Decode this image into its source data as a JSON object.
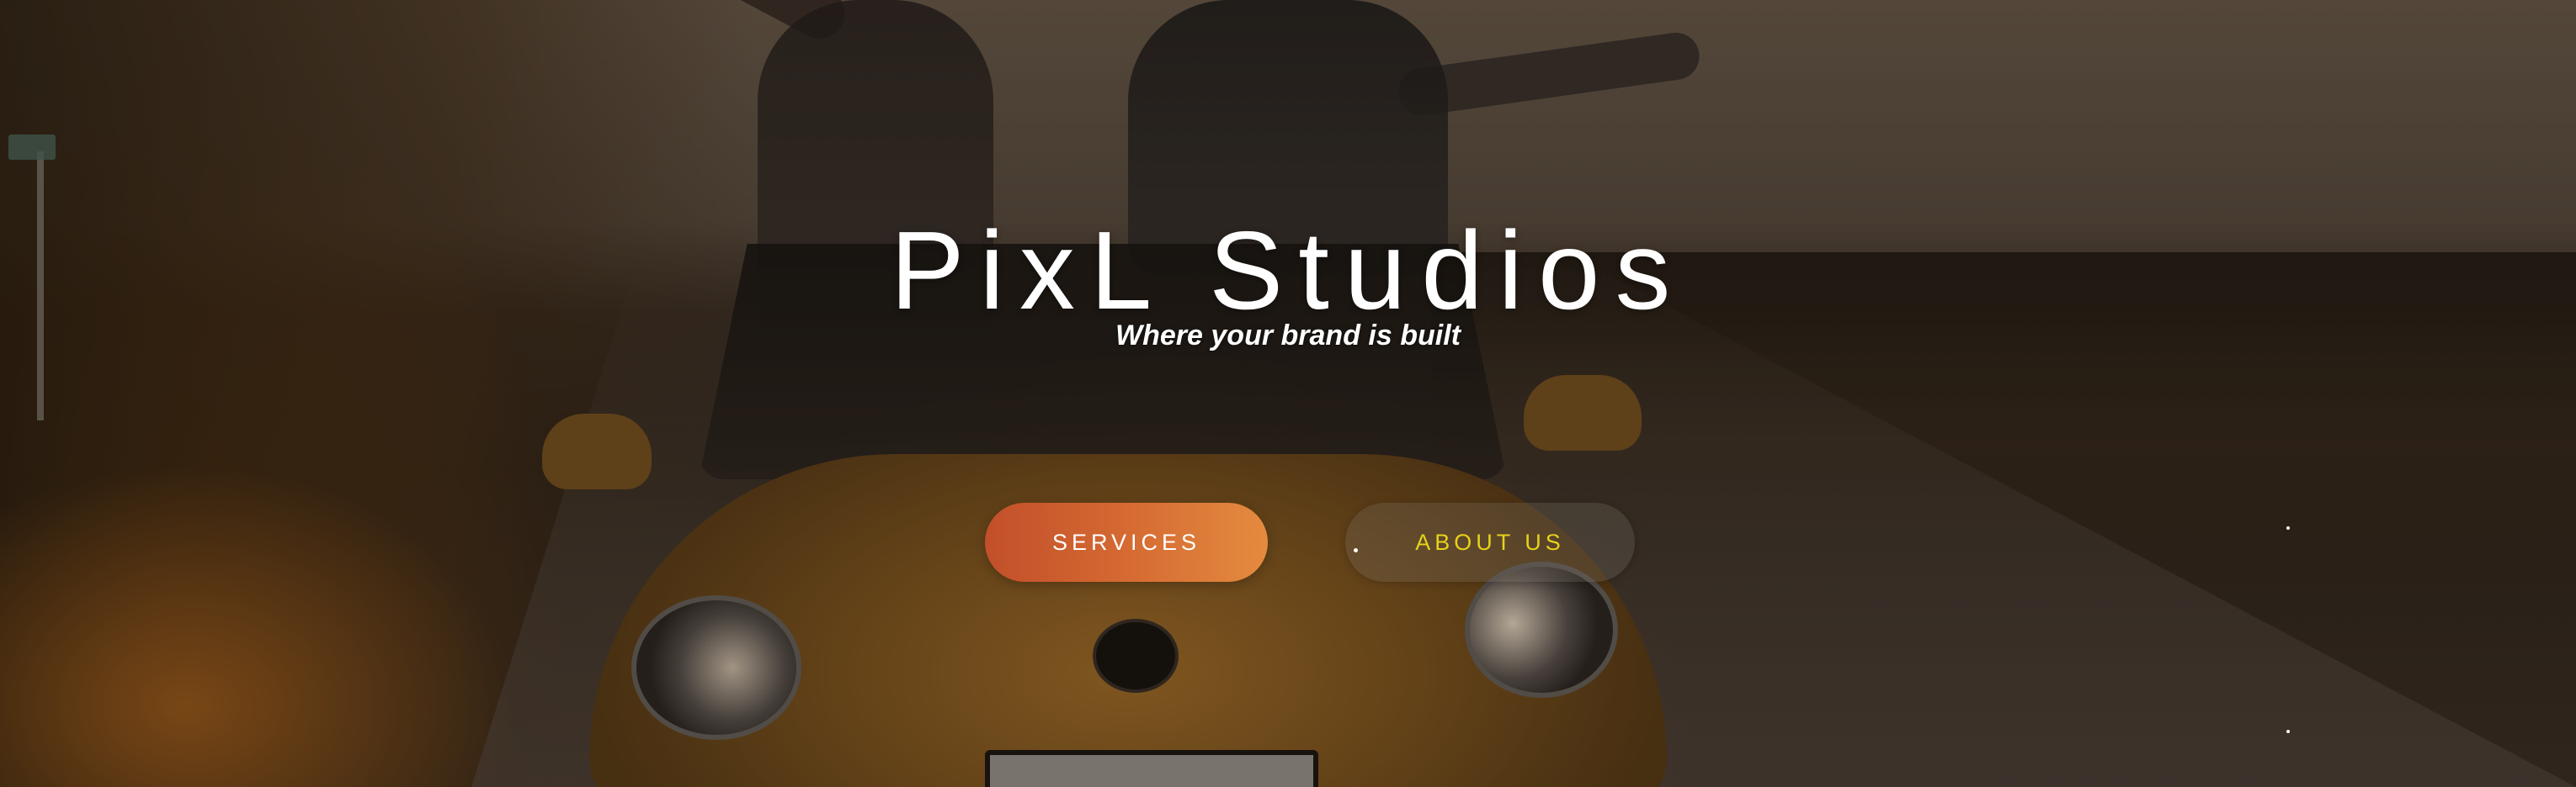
{
  "hero": {
    "title": "PixL Studios",
    "tagline": "Where your brand is built"
  },
  "buttons": {
    "services_label": "SERVICES",
    "about_label": "ABOUT US"
  },
  "colors": {
    "services_gradient_start": "#c24f2a",
    "services_gradient_end": "#e48b3f",
    "about_text": "#e6d21a",
    "title_text": "#ffffff"
  },
  "background": {
    "description_icon": "hero-background-photo"
  }
}
